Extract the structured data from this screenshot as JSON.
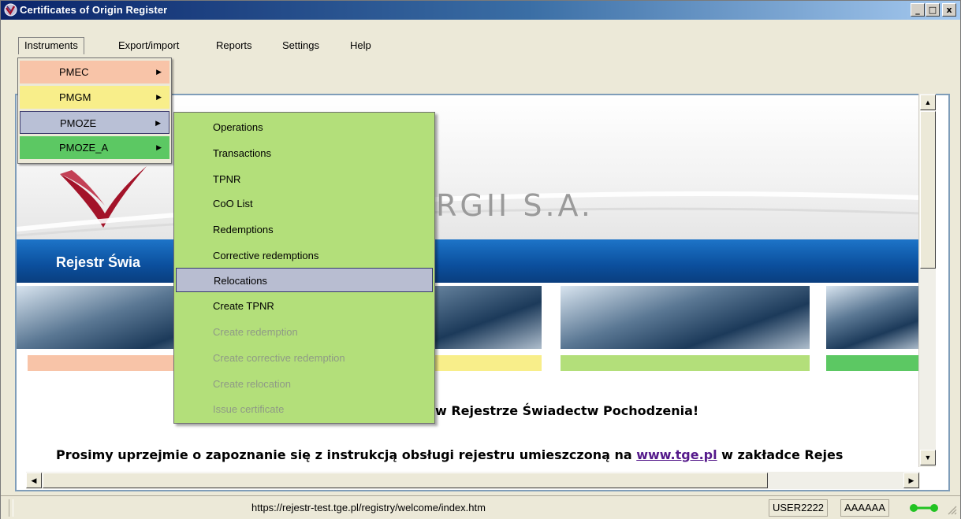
{
  "window": {
    "title": "Certificates of Origin Register",
    "controls": {
      "minimize": "_",
      "maximize": "□",
      "close": "x"
    }
  },
  "menubar": {
    "items": [
      {
        "label": "Instruments"
      },
      {
        "label": "Export/import"
      },
      {
        "label": "Reports"
      },
      {
        "label": "Settings"
      },
      {
        "label": "Help"
      }
    ]
  },
  "instruments_menu": {
    "items": [
      {
        "label": "PMEC",
        "color": "#f8c4a8"
      },
      {
        "label": "PMGM",
        "color": "#f8ee8a"
      },
      {
        "label": "PMOZE",
        "color": "#b9c0d6"
      },
      {
        "label": "PMOZE_A",
        "color": "#5cc863"
      }
    ]
  },
  "pmoze_submenu": {
    "items": [
      {
        "label": "Operations",
        "enabled": true
      },
      {
        "label": "Transactions",
        "enabled": true
      },
      {
        "label": "TPNR",
        "enabled": true
      },
      {
        "label": "CoO List",
        "enabled": true
      },
      {
        "label": "Redemptions",
        "enabled": true
      },
      {
        "label": "Corrective redemptions",
        "enabled": true
      },
      {
        "label": "Relocations",
        "enabled": true,
        "highlighted": true
      },
      {
        "label": "Create TPNR",
        "enabled": true
      },
      {
        "label": "Create redemption",
        "enabled": false
      },
      {
        "label": "Create corrective redemption",
        "enabled": false
      },
      {
        "label": "Create relocation",
        "enabled": false
      },
      {
        "label": "Issue certificate",
        "enabled": false
      }
    ]
  },
  "content": {
    "company_fragment": "RGII S.A.",
    "band_title": "Rejestr Świa",
    "welcome": "w Rejestrze Świadectw Pochodzenia!",
    "info_prefix": "Prosimy uprzejmie o zapoznanie się z instrukcją obsługi rejestru umieszczoną na ",
    "info_link": "www.tge.pl",
    "info_suffix": " w zakładce Rejes",
    "stripe_colors": [
      "#f8c4a8",
      "#f8ee8a",
      "#b3df7a",
      "#5cc863"
    ]
  },
  "statusbar": {
    "url": "https://rejestr-test.tge.pl/registry/welcome/index.htm",
    "user": "USER2222",
    "account": "AAAAAA",
    "connection_color": "#22c322"
  }
}
